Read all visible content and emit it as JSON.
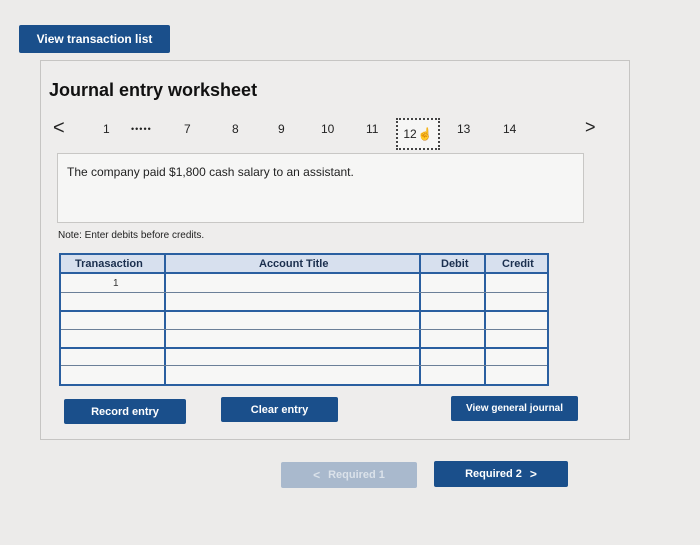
{
  "top": {
    "view_transaction_list_label": "View transaction list"
  },
  "worksheet": {
    "title": "Journal entry worksheet",
    "pager": {
      "prev": "<",
      "next": ">",
      "first": "1",
      "ellipsis": "•••••",
      "pages": [
        "7",
        "8",
        "9",
        "10",
        "11",
        "12",
        "13",
        "14"
      ],
      "current_page": "12"
    },
    "description": "The company paid $1,800 cash salary to an assistant.",
    "note": "Note: Enter debits before credits.",
    "table": {
      "columns": [
        "Tranasaction",
        "Account Title",
        "Debit",
        "Credit"
      ],
      "first_row_transaction": "1"
    },
    "buttons": {
      "record": "Record entry",
      "clear": "Clear entry",
      "view_general_journal": "View general journal"
    }
  },
  "footer_nav": {
    "prev_label": "Required 1",
    "next_label": "Required 2",
    "prev_chevron": "<",
    "next_chevron": ">"
  }
}
